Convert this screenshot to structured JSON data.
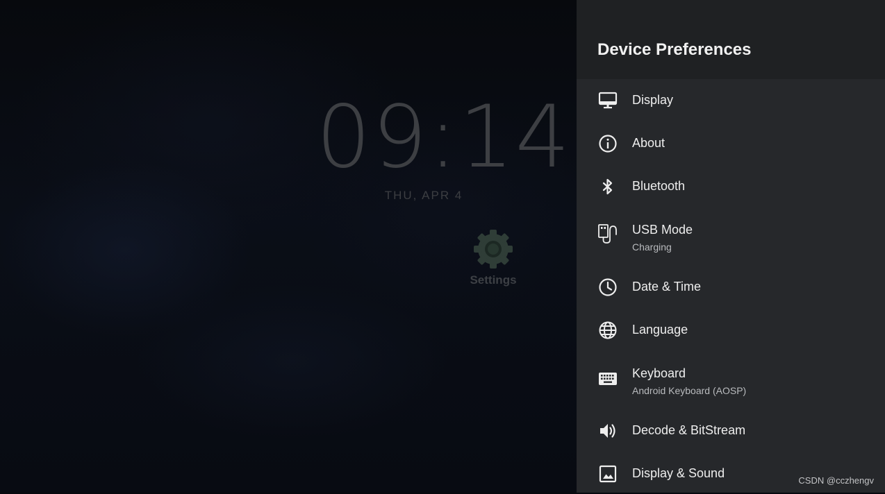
{
  "home": {
    "clock": "09:14",
    "date": "THU, APR 4",
    "app_label": "Settings",
    "app_icon": "gear-icon"
  },
  "panel": {
    "title": "Device Preferences",
    "items": [
      {
        "label": "Display",
        "sublabel": "",
        "icon": "monitor-icon"
      },
      {
        "label": "About",
        "sublabel": "",
        "icon": "info-icon"
      },
      {
        "label": "Bluetooth",
        "sublabel": "",
        "icon": "bluetooth-icon"
      },
      {
        "label": "USB Mode",
        "sublabel": "Charging",
        "icon": "usb-icon"
      },
      {
        "label": "Date & Time",
        "sublabel": "",
        "icon": "clock-icon"
      },
      {
        "label": "Language",
        "sublabel": "",
        "icon": "globe-icon"
      },
      {
        "label": "Keyboard",
        "sublabel": "Android Keyboard (AOSP)",
        "icon": "keyboard-icon"
      },
      {
        "label": "Decode & BitStream",
        "sublabel": "",
        "icon": "volume-icon"
      },
      {
        "label": "Display & Sound",
        "sublabel": "",
        "icon": "image-icon"
      }
    ]
  },
  "watermark": "CSDN @cczhengv",
  "colors": {
    "panel_bg": "#26282b",
    "header_bg": "#1f2123",
    "text": "#eeeeee",
    "subtext": "#b9bbbe"
  }
}
